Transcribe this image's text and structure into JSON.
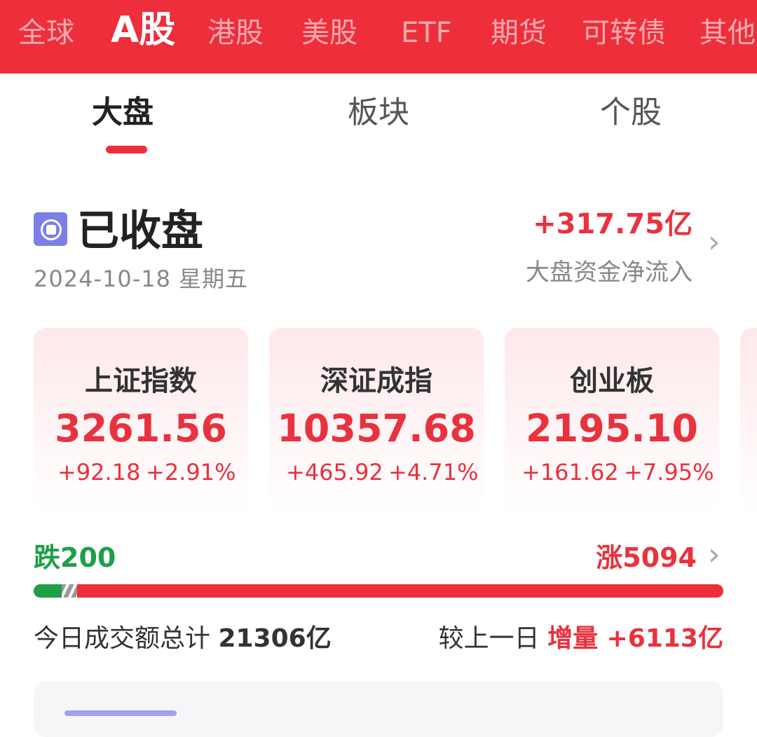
{
  "market_tabs": [
    "全球",
    "A股",
    "港股",
    "美股",
    "ETF",
    "期货",
    "可转债",
    "其他"
  ],
  "sub_tabs": [
    "大盘",
    "板块",
    "个股"
  ],
  "status": {
    "title": "已收盘",
    "date": "2024-10-18 星期五",
    "flow_value": "+317.75亿",
    "flow_label": "大盘资金净流入"
  },
  "indices": [
    {
      "name": "上证指数",
      "value": "3261.56",
      "change": "+92.18",
      "pct": "+2.91%"
    },
    {
      "name": "深证成指",
      "value": "10357.68",
      "change": "+465.92",
      "pct": "+4.71%"
    },
    {
      "name": "创业板",
      "value": "2195.10",
      "change": "+161.62",
      "pct": "+7.95%"
    }
  ],
  "breadth": {
    "down_label": "跌200",
    "up_label": "涨5094",
    "down_count": 200,
    "up_count": 5094
  },
  "volume": {
    "label": "今日成交额总计",
    "total": "21306亿",
    "compare_label": "较上一日",
    "change_type": "增量",
    "change_value": "+6113亿"
  },
  "colors": {
    "brand_red": "#ee2e3b",
    "up": "#e8323e",
    "down": "#1e9f47",
    "status_icon": "#7b7fe6"
  }
}
